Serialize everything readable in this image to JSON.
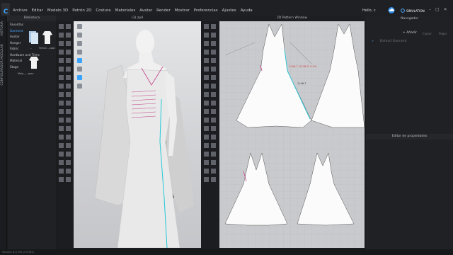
{
  "app": {
    "logo": "C"
  },
  "menu": [
    "Archivo",
    "Editar",
    "Modelo 3D",
    "Patrón 2D",
    "Costura",
    "Materiales",
    "Avatar",
    "Render",
    "Mostrar",
    "Preferencias",
    "Ajustes",
    "Ayuda"
  ],
  "header": {
    "user": "Hello, c",
    "mode": "SIMULATION"
  },
  "left_tabs": [
    "HISTORIA",
    "CONFIGURADOR MODULAR"
  ],
  "library": {
    "title": "Biblioteca",
    "tree": [
      "Favoritas",
      "Garment",
      "Avatar",
      "Hanger",
      "Fabric",
      "Hardware and Trims",
      "Material",
      "Stage"
    ],
    "selected": "Garment",
    "thumbs": [
      {
        "label": ".."
      },
      {
        "label": "Femal....zpac"
      },
      {
        "label": "Male_....zpac"
      }
    ]
  },
  "view3d": {
    "title": "(3).zpd"
  },
  "view2d": {
    "title": "2D Pattern Window",
    "annotations": [
      "1146.7 (1146.7) 0.0%",
      "1146.7"
    ]
  },
  "right": {
    "navigator_title": "Navegador",
    "add_label": "Añadir",
    "tabs": [
      "Copiar",
      "Pegar"
    ],
    "row_label": "Default Garment",
    "properties_title": "Editor de propiedades"
  },
  "status": "Version: 6.0.750 (r37345)",
  "colors": {
    "accent": "#4ea8ff",
    "seam": "#22c9d8",
    "stitch": "#c0408a"
  }
}
